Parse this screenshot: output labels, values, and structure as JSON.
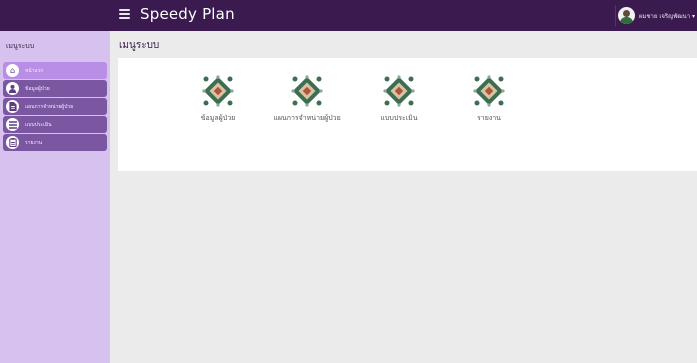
{
  "header": {
    "app_title": "Speedy Plan",
    "user_name": "ผมชาย เจริญพัฒนา ▾",
    "colors": {
      "navbar": "#3a1a4f",
      "sidebar": "#d6c1ef",
      "active_item": "#b88ee6",
      "item": "#7b57a1"
    }
  },
  "sidebar": {
    "heading": "เมนูระบบ",
    "items": [
      {
        "label": "หน้าแรก",
        "icon": "home-icon",
        "active": true
      },
      {
        "label": "ข้อมูลผู้ป่วย",
        "icon": "user-icon",
        "active": false
      },
      {
        "label": "แผนการจำหน่ายผู้ป่วย",
        "icon": "file-icon",
        "active": false
      },
      {
        "label": "แบบประเมิน",
        "icon": "list-icon",
        "active": false
      },
      {
        "label": "รายงาน",
        "icon": "report-icon",
        "active": false
      }
    ]
  },
  "main": {
    "page_title": "เมนูระบบ",
    "menu": [
      {
        "label": "ข้อมูลผู้ป่วย",
        "icon": "ornament-icon"
      },
      {
        "label": "แผนการจำหน่ายผู้ป่วย",
        "icon": "ornament-icon"
      },
      {
        "label": "แบบประเมิน",
        "icon": "ornament-icon"
      },
      {
        "label": "รายงาน",
        "icon": "ornament-icon"
      }
    ]
  }
}
